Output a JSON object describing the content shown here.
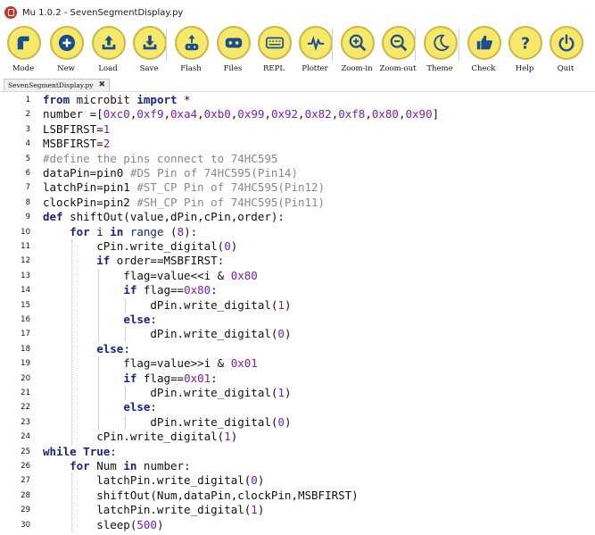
{
  "window": {
    "title": "Mu 1.0.2 - SevenSegmentDisplay.py"
  },
  "toolbar": {
    "buttons": [
      {
        "label": "Mode",
        "icon": "mode-icon"
      },
      {
        "label": "New",
        "icon": "plus-icon"
      },
      {
        "label": "Load",
        "icon": "upload-icon"
      },
      {
        "label": "Save",
        "icon": "download-icon"
      },
      {
        "label": "Flash",
        "icon": "flash-icon"
      },
      {
        "label": "Files",
        "icon": "files-icon"
      },
      {
        "label": "REPL",
        "icon": "keyboard-icon"
      },
      {
        "label": "Plotter",
        "icon": "pulse-icon"
      },
      {
        "label": "Zoom-in",
        "icon": "zoom-in-icon"
      },
      {
        "label": "Zoom-out",
        "icon": "zoom-out-icon"
      },
      {
        "label": "Theme",
        "icon": "moon-icon"
      },
      {
        "label": "Check",
        "icon": "thumbs-up-icon"
      },
      {
        "label": "Help",
        "icon": "question-icon"
      },
      {
        "label": "Quit",
        "icon": "power-icon"
      }
    ]
  },
  "tab": {
    "label": "SevenSegmentDisplay.py",
    "close": "✖"
  },
  "colors": {
    "button_fill": "#f7e76b",
    "keyword": "#1a237e",
    "number": "#7b1fa2",
    "comment": "#888888"
  },
  "editor": {
    "lines": [
      "from microbit import *",
      "number =[0xc0,0xf9,0xa4,0xb0,0x99,0x92,0x82,0xf8,0x80,0x90]",
      "LSBFIRST=1",
      "MSBFIRST=2",
      "#define the pins connect to 74HC595",
      "dataPin=pin0 #DS Pin of 74HC595(Pin14)",
      "latchPin=pin1 #ST_CP Pin of 74HC595(Pin12)",
      "clockPin=pin2 #SH_CP Pin of 74HC595(Pin11)",
      "def shiftOut(value,dPin,cPin,order):",
      "    for i in range (8):",
      "        cPin.write_digital(0)",
      "        if order==MSBFIRST:",
      "            flag=value<<i & 0x80",
      "            if flag==0x80:",
      "                dPin.write_digital(1)",
      "            else:",
      "                dPin.write_digital(0)",
      "        else:",
      "            flag=value>>i & 0x01",
      "            if flag==0x01:",
      "                dPin.write_digital(1)",
      "            else:",
      "                dPin.write_digital(0)",
      "        cPin.write_digital(1)",
      "while True:",
      "    for Num in number:",
      "        latchPin.write_digital(0)",
      "        shiftOut(Num,dataPin,clockPin,MSBFIRST)",
      "        latchPin.write_digital(1)",
      "        sleep(500)"
    ]
  }
}
